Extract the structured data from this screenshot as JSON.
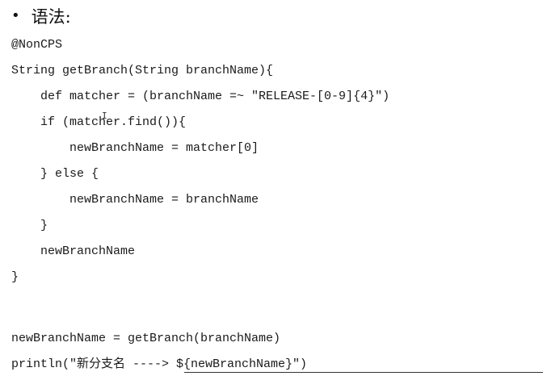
{
  "heading": {
    "bullet": "•",
    "title": "语法:"
  },
  "code_lines": [
    "@NonCPS",
    "String getBranch(String branchName){",
    "def matcher = (branchName =~ \"RELEASE-[0-9]{4}\")",
    "if (matcher.find()){",
    "newBranchName = matcher[0]",
    "} else {",
    "newBranchName = branchName",
    "}",
    "newBranchName",
    "}",
    "newBranchName = getBranch(branchName)",
    "println(\"新分支名 ----> ${newBranchName}\")"
  ]
}
